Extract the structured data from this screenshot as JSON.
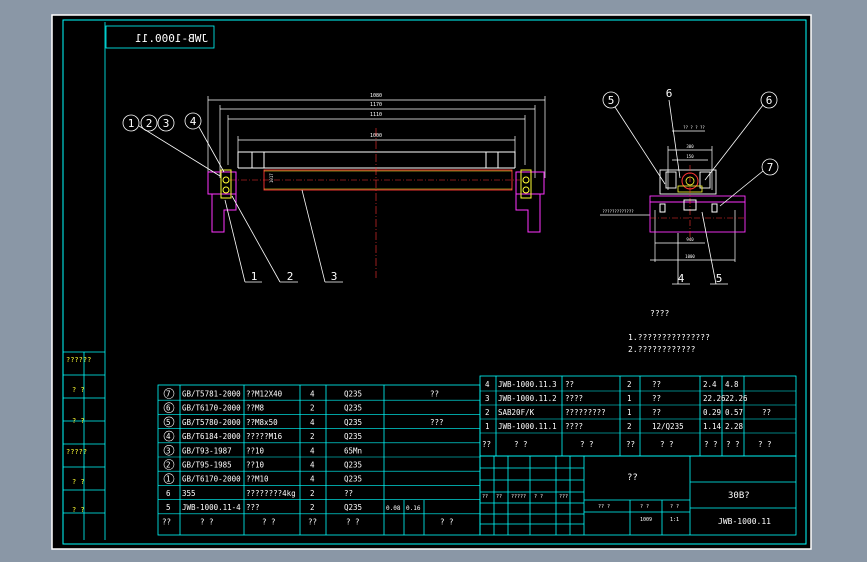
{
  "window": {
    "background": "#8a97a6",
    "paper": "#000000",
    "frame_color": "#00ffff",
    "line_color": "#00ff66",
    "text_color": "#ffffff",
    "accent_red": "#ff3333",
    "accent_magenta": "#ff33ff",
    "accent_yellow": "#ffff33"
  },
  "drawing_code_mirrored": "JWB-1000.11",
  "front_view": {
    "dims": [
      "1080",
      "1170",
      "1110",
      "1000"
    ],
    "height_dim": "1017",
    "balloons_top": [
      "1",
      "2",
      "3",
      "4"
    ],
    "balloons_bottom": [
      "1",
      "2",
      "3"
    ]
  },
  "side_view": {
    "balloons": [
      "5",
      "6",
      "6",
      "7"
    ],
    "balloons_bottom": [
      "4",
      "5"
    ],
    "dims_top": [
      "300",
      "150"
    ],
    "dims_bottom": [
      "940",
      "1000"
    ],
    "label_top": "?? ? ? ??",
    "label_left": "?????????????"
  },
  "notes": {
    "title": "????",
    "line1": "1.???????????????",
    "line2": "2.????????????"
  },
  "side_strip": [
    "??????",
    "? ?",
    "? ?",
    "?????",
    "? ?",
    "? ?"
  ],
  "parts_left": [
    {
      "no": "7",
      "code": "GB/T5781-2000",
      "name": "??M12X40",
      "qty": "4",
      "mat": "Q235",
      "note": "??"
    },
    {
      "no": "6",
      "code": "GB/T6170-2000",
      "name": "??M8",
      "qty": "2",
      "mat": "Q235",
      "note": ""
    },
    {
      "no": "5",
      "code": "GB/T5780-2000",
      "name": "??M8x50",
      "qty": "4",
      "mat": "Q235",
      "note": "???"
    },
    {
      "no": "4",
      "code": "GB/T6184-2000",
      "name": "?????M16",
      "qty": "2",
      "mat": "Q235",
      "note": ""
    },
    {
      "no": "3",
      "code": "GB/T93-1987",
      "name": "??10",
      "qty": "4",
      "mat": "65Mn",
      "note": ""
    },
    {
      "no": "2",
      "code": "GB/T95-1985",
      "name": "??10",
      "qty": "4",
      "mat": "Q235",
      "note": ""
    },
    {
      "no": "1",
      "code": "GB/T6170-2000",
      "name": "??M10",
      "qty": "4",
      "mat": "Q235",
      "note": ""
    },
    {
      "no": "6",
      "code": "355",
      "name": "????????4kg",
      "qty": "2",
      "mat": "??",
      "note": ""
    },
    {
      "no": "5",
      "code": "JWB-1000.11-4",
      "name": "???",
      "qty": "2",
      "mat": "Q235",
      "note": ""
    }
  ],
  "parts_left_extra": {
    "w1": "0.08",
    "w2": "0.16"
  },
  "parts_left_header": [
    "??",
    "?  ?",
    "?  ?",
    "??",
    "?  ?",
    "?  ?"
  ],
  "parts_right": [
    {
      "no": "4",
      "code": "JWB-1000.11.3",
      "name": "??",
      "qty": "2",
      "mat": "??",
      "w1": "2.4",
      "w2": "4.8",
      "note": ""
    },
    {
      "no": "3",
      "code": "JWB-1000.11.2",
      "name": "????",
      "qty": "1",
      "mat": "??",
      "w1": "22.26",
      "w2": "22.26",
      "note": ""
    },
    {
      "no": "2",
      "code": "SAB20F/K",
      "name": "?????????",
      "qty": "1",
      "mat": "??",
      "w1": "0.29",
      "w2": "0.57",
      "note": "??"
    },
    {
      "no": "1",
      "code": "JWB-1000.11.1",
      "name": "????",
      "qty": "2",
      "mat": "12/Q235",
      "w1": "1.14",
      "w2": "2.28",
      "note": ""
    }
  ],
  "parts_right_header": [
    "??",
    "?  ?",
    "?  ?",
    "??",
    "?  ?",
    "? ?",
    "? ?",
    "?  ?"
  ],
  "title_block": {
    "part_name": "??",
    "project": "30B?",
    "code": "JWB-1000.11",
    "scale_labels": [
      "?? ?",
      "?  ?",
      "?  ?"
    ],
    "scale_values": [
      "",
      "1009",
      "1:1"
    ]
  },
  "revision_labels": [
    "??",
    "??",
    "?????",
    "? ?",
    "???"
  ]
}
